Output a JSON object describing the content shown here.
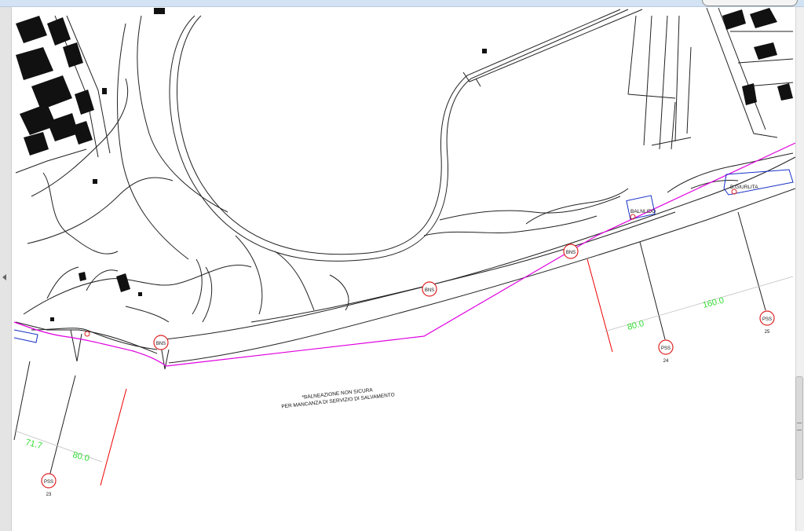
{
  "note": {
    "line1": "*BALNEAZIONE NON SICURA",
    "line2": "PER MANCANZA DI SERVIZIO DI SALVAMENTO"
  },
  "badges": {
    "bns": "BNS",
    "pss": "PSS"
  },
  "pss_numbers": [
    "23",
    "24",
    "25"
  ],
  "distances": [
    "71.7",
    "80.0",
    "80.0",
    "160.0"
  ],
  "establishments": [
    "BALNLIDO",
    "B.GIURLITA"
  ],
  "colors": {
    "coastline": "#e000e0",
    "distance_text": "#33dd33",
    "red_line": "#ee0000",
    "concession_box": "#1530c8",
    "badge": "#dd2222"
  }
}
